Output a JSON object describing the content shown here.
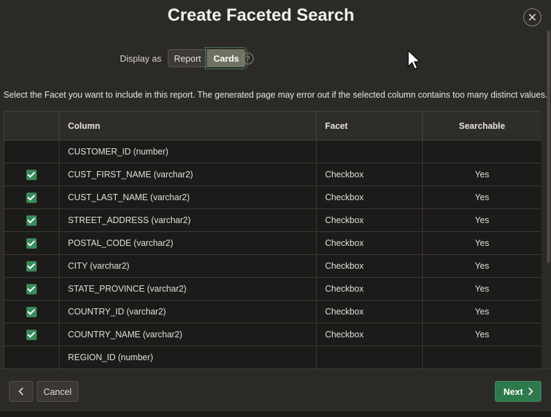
{
  "dialog": {
    "title": "Create Faceted Search",
    "close_icon": "close-icon"
  },
  "display_as": {
    "label": "Display as",
    "options": [
      "Report",
      "Cards"
    ],
    "selected": "Cards",
    "help_icon": "help-icon"
  },
  "instructions": "Select the Facet you want to include in this report. The generated page may error out if the selected column contains too many distinct values.",
  "grid": {
    "columns": [
      "",
      "Column",
      "Facet",
      "Searchable"
    ],
    "rows": [
      {
        "checked": false,
        "column": "CUSTOMER_ID (number)",
        "facet": "",
        "searchable": ""
      },
      {
        "checked": true,
        "column": "CUST_FIRST_NAME (varchar2)",
        "facet": "Checkbox",
        "searchable": "Yes"
      },
      {
        "checked": true,
        "column": "CUST_LAST_NAME (varchar2)",
        "facet": "Checkbox",
        "searchable": "Yes"
      },
      {
        "checked": true,
        "column": "STREET_ADDRESS (varchar2)",
        "facet": "Checkbox",
        "searchable": "Yes"
      },
      {
        "checked": true,
        "column": "POSTAL_CODE (varchar2)",
        "facet": "Checkbox",
        "searchable": "Yes"
      },
      {
        "checked": true,
        "column": "CITY (varchar2)",
        "facet": "Checkbox",
        "searchable": "Yes"
      },
      {
        "checked": true,
        "column": "STATE_PROVINCE (varchar2)",
        "facet": "Checkbox",
        "searchable": "Yes"
      },
      {
        "checked": true,
        "column": "COUNTRY_ID (varchar2)",
        "facet": "Checkbox",
        "searchable": "Yes"
      },
      {
        "checked": true,
        "column": "COUNTRY_NAME (varchar2)",
        "facet": "Checkbox",
        "searchable": "Yes"
      },
      {
        "checked": false,
        "column": "REGION_ID (number)",
        "facet": "",
        "searchable": ""
      }
    ]
  },
  "footer": {
    "prev_icon": "chevron-left-icon",
    "cancel_label": "Cancel",
    "next_label": "Next",
    "next_icon": "chevron-right-icon"
  },
  "colors": {
    "accent": "#2f7a4d",
    "checkbox": "#3a8a5a",
    "selected_segment": "#6e7361"
  }
}
